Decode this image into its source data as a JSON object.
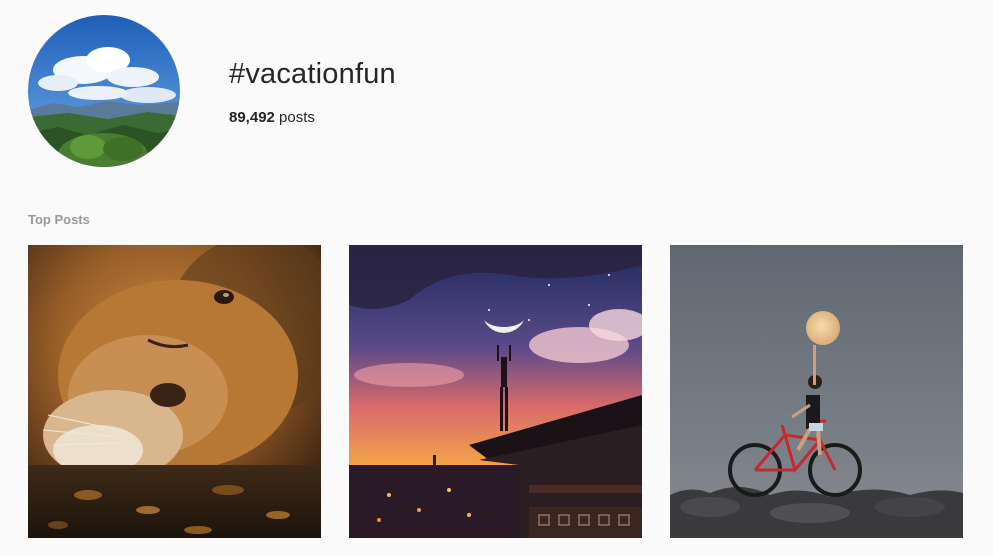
{
  "hashtag": {
    "title": "#vacationfun",
    "post_count": "89,492",
    "post_count_suffix": " posts"
  },
  "sections": {
    "top_posts_label": "Top Posts"
  },
  "posts": [
    {
      "subject": "lion-resting-photo"
    },
    {
      "subject": "sunset-moon-rooftop-photo"
    },
    {
      "subject": "moon-cyclist-photo"
    }
  ]
}
